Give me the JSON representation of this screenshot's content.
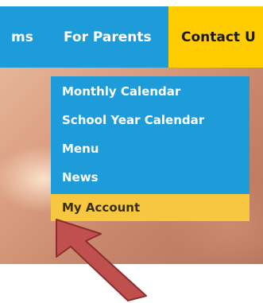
{
  "nav": {
    "items": [
      {
        "label": "ms"
      },
      {
        "label": "For Parents"
      },
      {
        "label": "Contact U"
      }
    ]
  },
  "dropdown": {
    "items": [
      {
        "label": "Monthly Calendar"
      },
      {
        "label": "School Year Calendar"
      },
      {
        "label": "Menu"
      },
      {
        "label": "News"
      },
      {
        "label": "My Account"
      }
    ],
    "highlighted_item": "My Account"
  },
  "colors": {
    "nav_blue": "#1e9bd9",
    "contact_yellow": "#ffcc00",
    "highlight_yellow": "#f7c740",
    "arrow_red": "#c0504d"
  },
  "annotation": {
    "icon": "red-arrow-icon"
  }
}
